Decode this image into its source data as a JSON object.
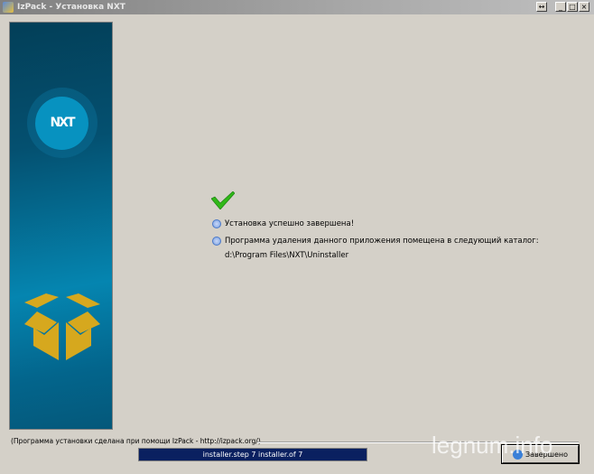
{
  "window": {
    "title": "IzPack - Установка  NXT",
    "restore_label": "↔",
    "minimize_label": "_",
    "maximize_label": "□",
    "close_label": "×"
  },
  "side": {
    "logo_text": "NXT"
  },
  "main": {
    "success_message": "Установка успешно завершена!",
    "uninstaller_message": "Программа удаления данного приложения помещена в следующий каталог:",
    "uninstaller_path": "d:\\Program Files\\NXT\\Uninstaller"
  },
  "footer": {
    "credit": "(Программа установки сделана при помощи IzPack - http://izpack.org/)",
    "progress_text": "installer.step 7 installer.of 7",
    "progress": {
      "step": 7,
      "total": 7
    },
    "finish_label": "Завершено"
  },
  "watermark": "legnum.info"
}
